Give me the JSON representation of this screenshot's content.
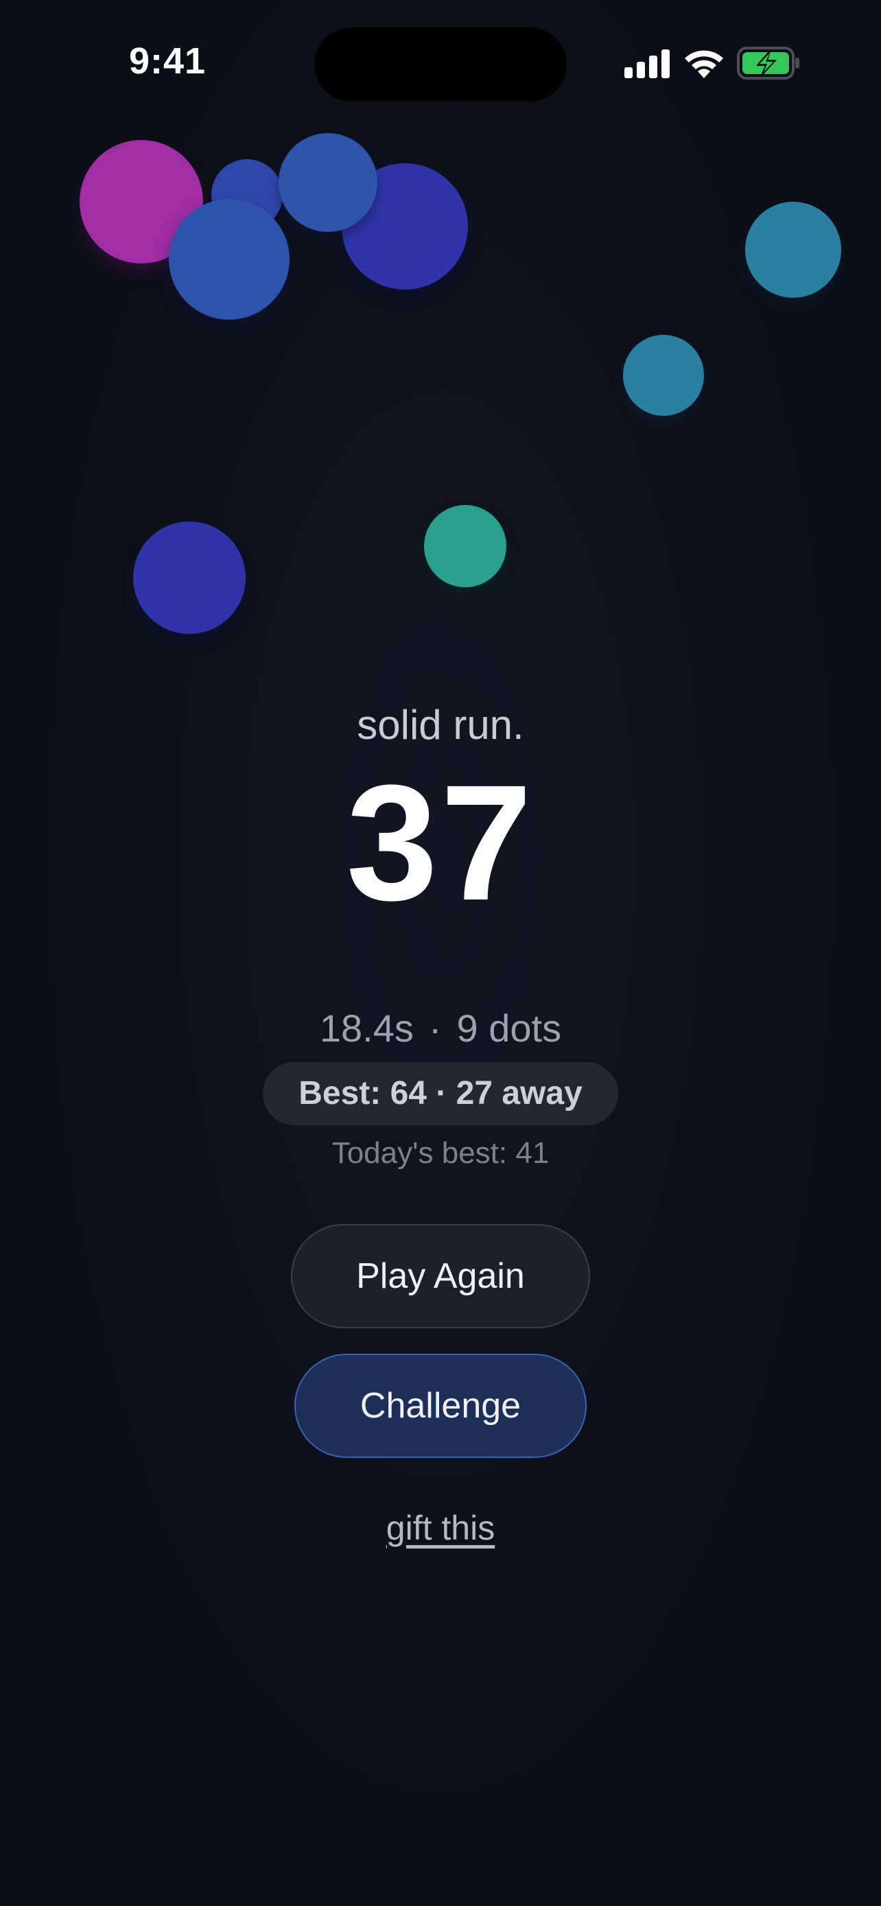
{
  "status_bar": {
    "time": "9:41",
    "battery_color": "#35c759"
  },
  "game": {
    "dot_colors": {
      "magenta": "#a22ea5",
      "blue": "#2e53ad",
      "indigo": "#2f35a8",
      "teal": "#2b80a2",
      "green": "#2ba08e"
    }
  },
  "result": {
    "tagline": "solid run.",
    "score": "37",
    "time": "18.4s",
    "separator": "·",
    "dots": "9 dots",
    "best": "Best: 64 · 27 away",
    "today_best": "Today's best: 41"
  },
  "actions": {
    "play_again": "Play Again",
    "challenge": "Challenge",
    "gift": "gift this"
  }
}
